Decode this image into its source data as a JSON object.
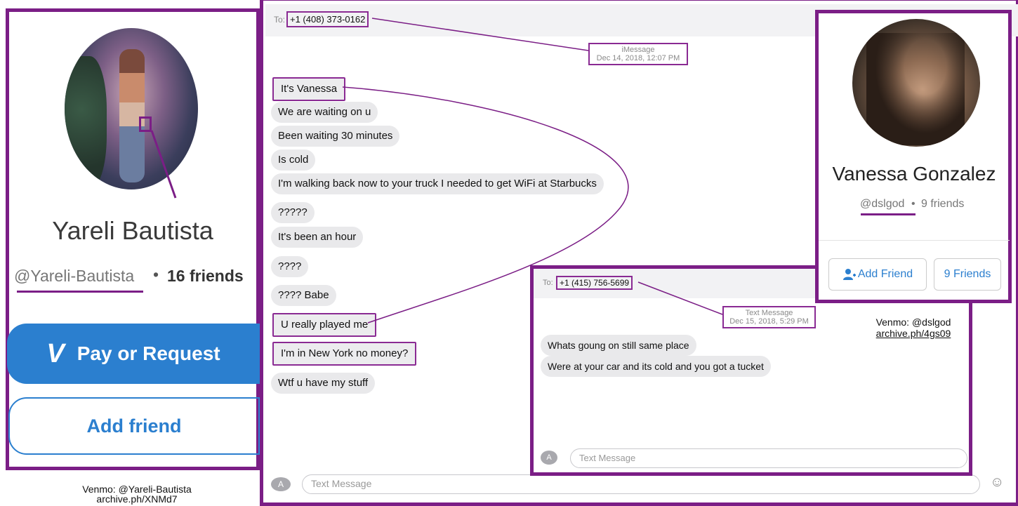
{
  "left_profile": {
    "name": "Yareli Bautista",
    "handle": "@Yareli-Bautista",
    "separator": "•",
    "friends": "16 friends",
    "pay_button": "Pay or Request",
    "pay_icon": "V",
    "add_friend": "Add friend",
    "caption_line1": "Venmo: @Yareli-Bautista",
    "caption_line2": "archive.ph/XNMd7"
  },
  "imessage": {
    "to_label": "To:",
    "to_number": "+1 (408) 373-0162",
    "service": "iMessage",
    "timestamp": "Dec 14, 2018, 12:07 PM",
    "messages": [
      "It's Vanessa",
      "We are waiting on u",
      "Been waiting 30 minutes",
      "Is cold",
      "I'm walking back now to your truck I needed to get WiFi at Starbucks",
      "?????",
      "It's been an hour",
      "????",
      "???? Babe",
      "U really played me",
      "I'm in New York no money?",
      "Wtf u have my stuff"
    ],
    "input_placeholder": "Text Message",
    "app_icon": "A",
    "emoji_icon": "☺"
  },
  "right_profile": {
    "name": "Vanessa Gonzalez",
    "handle": "@dslgod",
    "separator": "•",
    "friends": "9 friends",
    "add_friend": "Add Friend",
    "friends_button": "9 Friends",
    "caption_line1": "Venmo: @dslgod",
    "caption_line2": "archive.ph/4gs09"
  },
  "sms": {
    "to_label": "To:",
    "to_number": "+1 (415) 756-5699",
    "service": "Text Message",
    "timestamp": "Dec 15, 2018, 5:29 PM",
    "messages": [
      "Whats goung on still same place",
      "Were at your car and its cold and you got a tucket"
    ],
    "input_placeholder": "Text Message",
    "app_icon": "A"
  },
  "colors": {
    "highlight": "#7b1e86",
    "venmo_blue": "#2b7fcf",
    "bubble_gray": "#e9e9eb"
  }
}
